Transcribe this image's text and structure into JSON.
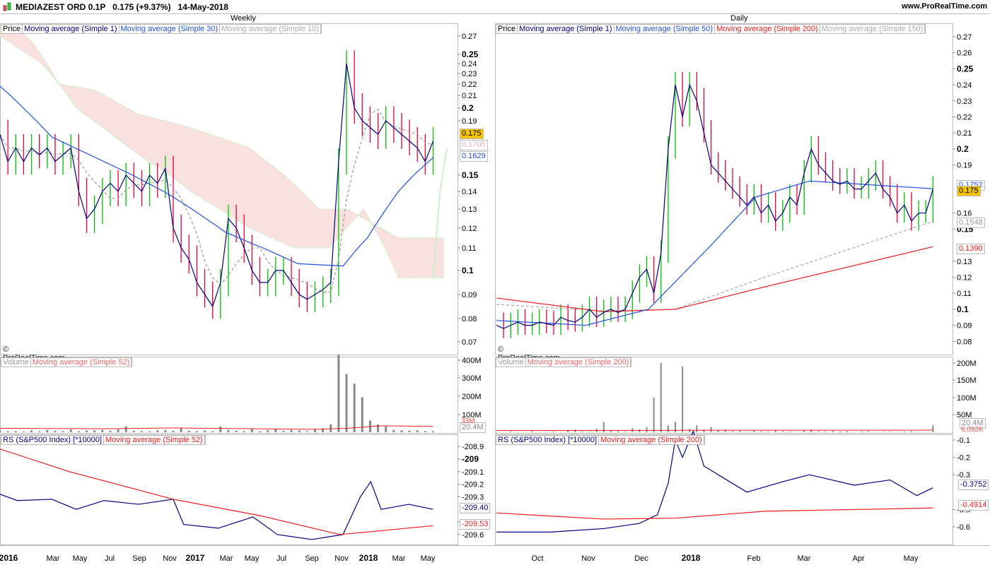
{
  "header": {
    "title": "MEDIAZEST ORD 0.1P   0.175 (+9.37%)   14-May-2018",
    "site": "www.ProRealTime.com"
  },
  "colors": {
    "up": "#00c000",
    "down": "#e0003c",
    "close": "#000080",
    "sma_blue": "#1f4fe0",
    "sma_red": "#ee1c1c",
    "sma_grey": "#999999",
    "cloud_red": "#fbe0e0",
    "cloud_green": "#e4f8e0",
    "badge": "#f5c400"
  },
  "weekly": {
    "title": "Weekly",
    "legend": [
      "Price",
      "Moving average (Simple 1)",
      "Moving average (Simple 30)",
      "Moving average (Simple 10)"
    ],
    "vol_legend": [
      "Volume",
      "Moving average (Simple 52)"
    ],
    "rs_legend": [
      "RS (S&P500 Index) [*10000]",
      "Moving average (Simple 52)"
    ],
    "copyright": "© ProRealTime.com",
    "x_labels": [
      "2016",
      "Mar",
      "May",
      "Jul",
      "Sep",
      "Nov",
      "2017",
      "Mar",
      "May",
      "Jul",
      "Sep",
      "Nov",
      "2018",
      "Mar",
      "May"
    ],
    "price_ticks": [
      "0.27",
      "0.25",
      "0.24",
      "0.23",
      "0.22",
      "0.21",
      "0.2",
      "0.19",
      "0.15",
      "0.14",
      "0.13",
      "0.12",
      "0.11",
      "0.1",
      "0.09",
      "0.08",
      "0.07"
    ],
    "price_badges": [
      "0.175",
      "0.1705",
      "0.1629"
    ],
    "vol_ticks": [
      "400M",
      "300M",
      "200M",
      "100M"
    ],
    "vol_badges": [
      "33M",
      "20.4M"
    ],
    "rs_ticks": [
      "-208.9",
      "-209",
      "-209.1",
      "-209.2",
      "-209.3",
      "-209.5",
      "-209.6"
    ],
    "rs_badges": [
      "-209.40",
      "-209.53"
    ]
  },
  "daily": {
    "title": "Daily",
    "legend": [
      "Price",
      "Moving average (Simple 1)",
      "Moving average (Simple 50)",
      "Moving average (Simple 200)",
      "Moving average (Simple 150)"
    ],
    "vol_legend": [
      "Volume",
      "Moving average (Simple 200)"
    ],
    "rs_legend": [
      "RS (S&P500 Index) [*10000]",
      "Moving average (Simple 200)"
    ],
    "copyright": "© ProRealTime.com",
    "x_labels": [
      "Oct",
      "Nov",
      "Dec",
      "2018",
      "Feb",
      "Mar",
      "Apr",
      "May"
    ],
    "price_ticks": [
      "0.27",
      "0.26",
      "0.25",
      "0.24",
      "0.23",
      "0.22",
      "0.21",
      "0.2",
      "0.19",
      "0.16",
      "0.15",
      "0.13",
      "0.12",
      "0.11",
      "0.1",
      "0.09",
      "0.08"
    ],
    "price_badges": [
      "0.1752",
      "0.175",
      "0.1548",
      "0.1390"
    ],
    "vol_ticks": [
      "200M",
      "150M",
      "100M",
      "50M"
    ],
    "vol_badges": [
      "20.4M",
      "6,092K"
    ],
    "rs_ticks": [
      "-0.1",
      "-0.2",
      "-0.3",
      "-0.5",
      "-0.6"
    ],
    "rs_badges": [
      "-0.3752",
      "-0.4914"
    ]
  },
  "chart_data": [
    {
      "type": "line",
      "name": "weekly-price",
      "x_unit": "weeks since Dec-2015",
      "close": [
        0.18,
        0.16,
        0.17,
        0.16,
        0.17,
        0.165,
        0.17,
        0.16,
        0.165,
        0.17,
        0.14,
        0.125,
        0.13,
        0.14,
        0.145,
        0.14,
        0.15,
        0.145,
        0.14,
        0.15,
        0.145,
        0.155,
        0.12,
        0.11,
        0.105,
        0.095,
        0.09,
        0.085,
        0.095,
        0.125,
        0.12,
        0.11,
        0.1,
        0.095,
        0.095,
        0.1,
        0.1,
        0.095,
        0.09,
        0.088,
        0.09,
        0.092,
        0.095,
        0.16,
        0.24,
        0.2,
        0.19,
        0.185,
        0.18,
        0.19,
        0.185,
        0.18,
        0.175,
        0.17,
        0.16,
        0.175
      ],
      "sma30": [
        [
          0,
          0.218
        ],
        [
          15,
          0.178
        ],
        [
          40,
          0.148
        ],
        [
          49,
          0.138
        ],
        [
          65,
          0.118
        ],
        [
          73,
          0.112
        ],
        [
          86,
          0.103
        ],
        [
          99,
          0.102
        ],
        [
          106,
          0.115
        ],
        [
          115,
          0.14
        ],
        [
          125,
          0.1629
        ]
      ],
      "cloud_top": [
        [
          0,
          0.3
        ],
        [
          10,
          0.26
        ],
        [
          17,
          0.22
        ],
        [
          27,
          0.215
        ],
        [
          40,
          0.195
        ],
        [
          55,
          0.185
        ],
        [
          72,
          0.17
        ],
        [
          82,
          0.15
        ],
        [
          92,
          0.13
        ],
        [
          100,
          0.13
        ],
        [
          115,
          0.115
        ],
        [
          128,
          0.115
        ]
      ],
      "cloud_bottom": [
        [
          0,
          0.27
        ],
        [
          12,
          0.24
        ],
        [
          22,
          0.2
        ],
        [
          40,
          0.165
        ],
        [
          55,
          0.14
        ],
        [
          72,
          0.12
        ],
        [
          85,
          0.11
        ],
        [
          95,
          0.11
        ],
        [
          105,
          0.13
        ],
        [
          115,
          0.097
        ],
        [
          128,
          0.097
        ]
      ],
      "volume_M": [
        8,
        5,
        6,
        4,
        10,
        5,
        12,
        8,
        6,
        14,
        5,
        9,
        10,
        12,
        8,
        15,
        30,
        8,
        6,
        5,
        10,
        12,
        7,
        20,
        8,
        6,
        9,
        5,
        30,
        12,
        8,
        6,
        18,
        5,
        10,
        15,
        8,
        12,
        10,
        5,
        14,
        20,
        40,
        400,
        300,
        250,
        180,
        60,
        40,
        30,
        12,
        10,
        8,
        10,
        6,
        5
      ],
      "vol_sma": [
        [
          0,
          20
        ],
        [
          30,
          18
        ],
        [
          50,
          22
        ],
        [
          90,
          15
        ],
        [
          100,
          20
        ],
        [
          110,
          33
        ],
        [
          125,
          30
        ]
      ],
      "rs": [
        [
          0,
          -209.28
        ],
        [
          5,
          -209.33
        ],
        [
          15,
          -209.32
        ],
        [
          22,
          -209.4
        ],
        [
          30,
          -209.33
        ],
        [
          40,
          -209.36
        ],
        [
          50,
          -209.32
        ],
        [
          53,
          -209.52
        ],
        [
          63,
          -209.55
        ],
        [
          73,
          -209.46
        ],
        [
          80,
          -209.6
        ],
        [
          90,
          -209.64
        ],
        [
          99,
          -209.6
        ],
        [
          104,
          -209.3
        ],
        [
          107,
          -209.18
        ],
        [
          110,
          -209.4
        ],
        [
          118,
          -209.36
        ],
        [
          125,
          -209.4
        ]
      ],
      "rs_sma": [
        [
          0,
          -208.92
        ],
        [
          20,
          -209.1
        ],
        [
          50,
          -209.32
        ],
        [
          75,
          -209.45
        ],
        [
          98,
          -209.6
        ],
        [
          110,
          -209.57
        ],
        [
          125,
          -209.53
        ]
      ]
    },
    {
      "type": "line",
      "name": "daily-price",
      "x_unit": "days since 12-Sep-2017",
      "close": [
        0.09,
        0.088,
        0.09,
        0.092,
        0.09,
        0.09,
        0.092,
        0.091,
        0.09,
        0.095,
        0.093,
        0.092,
        0.095,
        0.1,
        0.095,
        0.098,
        0.1,
        0.098,
        0.1,
        0.11,
        0.12,
        0.125,
        0.11,
        0.135,
        0.2,
        0.24,
        0.22,
        0.24,
        0.23,
        0.21,
        0.19,
        0.185,
        0.18,
        0.175,
        0.17,
        0.165,
        0.17,
        0.16,
        0.165,
        0.155,
        0.16,
        0.17,
        0.165,
        0.185,
        0.2,
        0.19,
        0.185,
        0.18,
        0.178,
        0.18,
        0.175,
        0.175,
        0.18,
        0.185,
        0.175,
        0.17,
        0.16,
        0.165,
        0.155,
        0.16,
        0.16,
        0.175
      ],
      "sma50": [
        [
          0,
          0.093
        ],
        [
          50,
          0.09
        ],
        [
          85,
          0.1
        ],
        [
          120,
          0.14
        ],
        [
          145,
          0.17
        ],
        [
          175,
          0.18
        ],
        [
          244,
          0.1752
        ]
      ],
      "sma150": [
        [
          0,
          0.103
        ],
        [
          60,
          0.099
        ],
        [
          100,
          0.1
        ],
        [
          150,
          0.12
        ],
        [
          244,
          0.1548
        ]
      ],
      "sma200": [
        [
          0,
          0.107
        ],
        [
          60,
          0.0985
        ],
        [
          100,
          0.1
        ],
        [
          150,
          0.114
        ],
        [
          244,
          0.139
        ]
      ],
      "volume_M": [
        1,
        1,
        2,
        1,
        1,
        3,
        1,
        1,
        2,
        1,
        5,
        8,
        3,
        2,
        10,
        30,
        5,
        3,
        2,
        12,
        8,
        15,
        100,
        200,
        20,
        30,
        190,
        10,
        20,
        8,
        15,
        5,
        8,
        3,
        4,
        2,
        5,
        3,
        2,
        6,
        3,
        2,
        1,
        5,
        8,
        3,
        2,
        4,
        2,
        3,
        1,
        2,
        3,
        1,
        2,
        2,
        1,
        2,
        3,
        1,
        1,
        20
      ],
      "vol_sma": [
        [
          0,
          5
        ],
        [
          244,
          6
        ]
      ],
      "rs": [
        [
          0,
          -0.63
        ],
        [
          30,
          -0.63
        ],
        [
          60,
          -0.61
        ],
        [
          80,
          -0.58
        ],
        [
          90,
          -0.53
        ],
        [
          96,
          -0.35
        ],
        [
          100,
          -0.1
        ],
        [
          104,
          -0.2
        ],
        [
          110,
          -0.05
        ],
        [
          116,
          -0.25
        ],
        [
          140,
          -0.4
        ],
        [
          160,
          -0.34
        ],
        [
          175,
          -0.3
        ],
        [
          200,
          -0.36
        ],
        [
          220,
          -0.33
        ],
        [
          235,
          -0.42
        ],
        [
          244,
          -0.3752
        ]
      ],
      "rs_sma": [
        [
          0,
          -0.52
        ],
        [
          60,
          -0.555
        ],
        [
          100,
          -0.55
        ],
        [
          150,
          -0.51
        ],
        [
          244,
          -0.4914
        ]
      ]
    }
  ]
}
